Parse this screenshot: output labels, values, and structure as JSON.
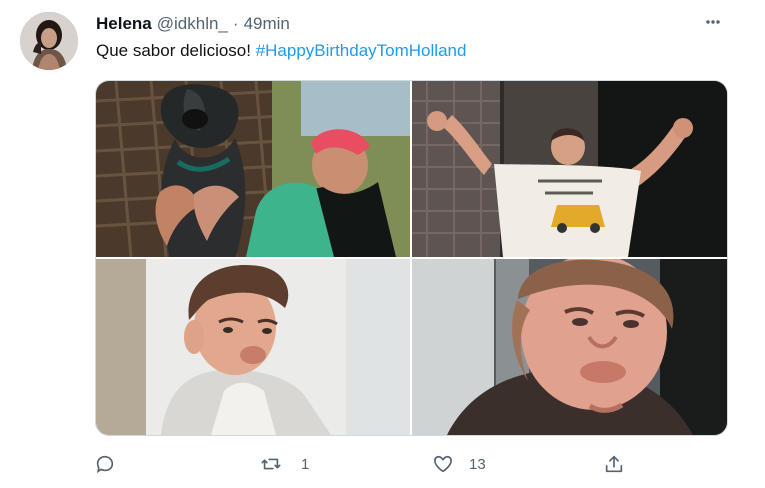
{
  "tweet": {
    "author_name": "Helena",
    "handle": "@idkhln_",
    "separator": "·",
    "time": "49min",
    "text_prefix": "Que sabor delicioso! ",
    "hashtag": "#HappyBirthdayTomHolland",
    "retweets": "1",
    "likes": "13"
  },
  "icons": [
    "more-icon",
    "reply-icon",
    "retweet-icon",
    "like-icon",
    "share-icon"
  ],
  "colors": {
    "accent": "#1d9bf0",
    "secondary": "#536471",
    "border": "#cfd9de"
  }
}
